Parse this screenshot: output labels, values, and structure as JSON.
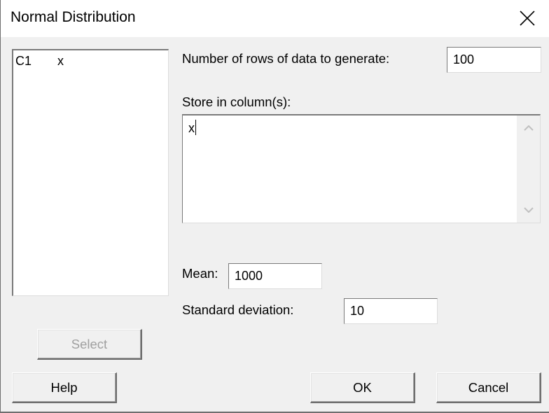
{
  "window": {
    "title": "Normal Distribution",
    "close_icon": "close-icon"
  },
  "column_list": {
    "items": [
      {
        "id": "C1",
        "name": "x"
      }
    ]
  },
  "rows": {
    "label": "Number of rows of data to generate:",
    "value": "100"
  },
  "store": {
    "label": "Store in column(s):",
    "value": "x",
    "scroll_up_icon": "chevron-up-icon",
    "scroll_down_icon": "chevron-down-icon"
  },
  "mean": {
    "label": "Mean:",
    "value": "1000"
  },
  "std": {
    "label": "Standard deviation:",
    "value": "10"
  },
  "buttons": {
    "select": "Select",
    "help": "Help",
    "ok": "OK",
    "cancel": "Cancel"
  }
}
